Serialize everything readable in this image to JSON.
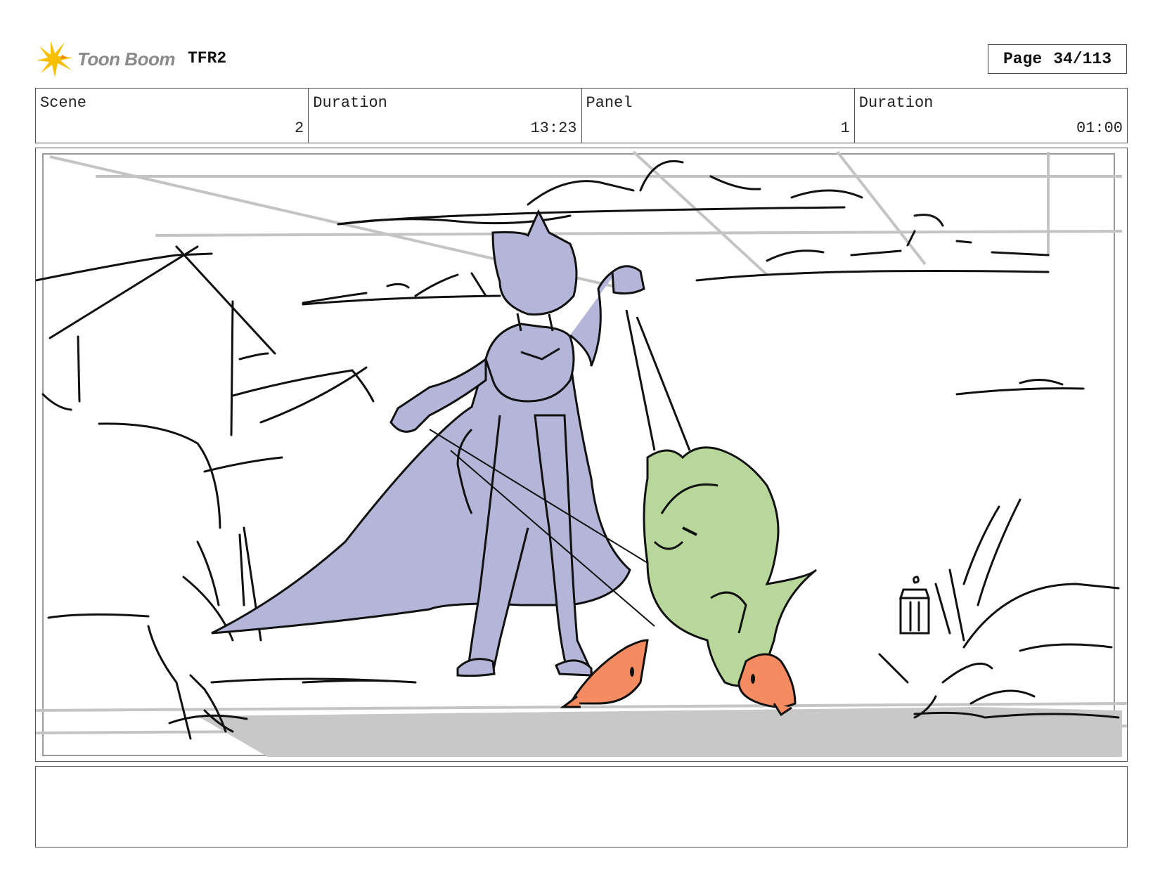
{
  "header": {
    "brand": "Toon Boom",
    "project": "TFR2",
    "page_label": "Page",
    "page_number": "34/113"
  },
  "info": {
    "scene_label": "Scene",
    "scene_value": "2",
    "scene_duration_label": "Duration",
    "scene_duration_value": "13:23",
    "panel_label": "Panel",
    "panel_value": "1",
    "panel_duration_label": "Duration",
    "panel_duration_value": "01:00"
  },
  "notes": {
    "text": ""
  },
  "colors": {
    "logo_yellow": "#f6c000",
    "cat_fill": "#b3b6d9",
    "gremlin_fill": "#b8d79a",
    "fish_fill": "#f58b60",
    "ground_fill": "#c8c8c8",
    "guide_lines": "#c4c4c4"
  }
}
